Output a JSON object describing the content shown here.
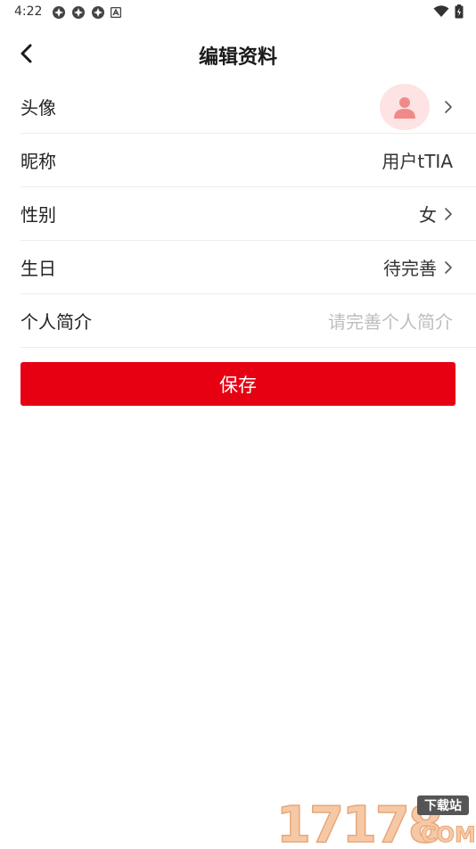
{
  "status_bar": {
    "time": "4:22"
  },
  "header": {
    "title": "编辑资料"
  },
  "rows": [
    {
      "label": "头像",
      "value": "",
      "type": "avatar"
    },
    {
      "label": "昵称",
      "value": "用户tTIA",
      "type": "value"
    },
    {
      "label": "性别",
      "value": "女",
      "type": "value"
    },
    {
      "label": "生日",
      "value": "待完善",
      "type": "value"
    },
    {
      "label": "个人简介",
      "placeholder": "请完善个人简介",
      "type": "input"
    }
  ],
  "save_label": "保存",
  "watermark": {
    "text": "17178.COM",
    "badge": "下载站"
  },
  "colors": {
    "accent": "#e60012",
    "avatar_bg": "#fde3e3",
    "avatar_icon": "#f08a8a",
    "divider": "#ededed",
    "placeholder": "#bdbdbd"
  }
}
